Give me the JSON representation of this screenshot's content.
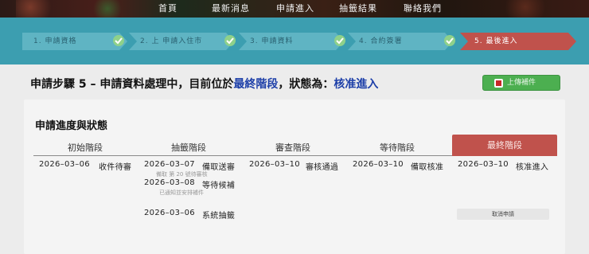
{
  "nav": {
    "items": [
      "首頁",
      "最新消息",
      "申請進入",
      "抽籤結果",
      "聯絡我們"
    ]
  },
  "steps": [
    {
      "label": "1. 申請資格",
      "done": true
    },
    {
      "label": "2. 上 申請入住市",
      "done": true
    },
    {
      "label": "3. 申請資料",
      "done": true
    },
    {
      "label": "4. 合約簽署",
      "done": true
    },
    {
      "label": "5. 最後進入",
      "done": false,
      "active": true
    }
  ],
  "status": {
    "prefix": "申請步驟 5 – 申請資料處理中，目前位於",
    "stage": "最終階段",
    "middle": "，狀態為：",
    "state": "核准進入"
  },
  "action_button": {
    "label": "上傳補件"
  },
  "progress": {
    "title": "申請進度與狀態",
    "columns": [
      "初始階段",
      "抽籤階段",
      "審查階段",
      "等待階段",
      "最終階段"
    ],
    "initial": {
      "date": "2026–03–06",
      "status": "收件待審"
    },
    "lottery": [
      {
        "date": "2026–03–07",
        "status": "備取送審",
        "note": "備取 第 20 號待審核"
      },
      {
        "date": "2026–03–08",
        "status": "等待候補",
        "note": "已通知並安排補件"
      },
      {
        "date": "2026–03–06",
        "status": "系統抽籤"
      }
    ],
    "review": {
      "date": "2026–03–10",
      "status": "審核通過"
    },
    "waiting": {
      "date": "2026–03–10",
      "status": "備取核准"
    },
    "final": {
      "date": "2026–03–10",
      "status": "核准進入"
    },
    "cancel_button": "取消申請"
  },
  "colors": {
    "steps_bar": "#3c9eb0",
    "active_step": "#c0524c",
    "highlight_text": "#1d3fa8",
    "action_button": "#4caf50"
  }
}
